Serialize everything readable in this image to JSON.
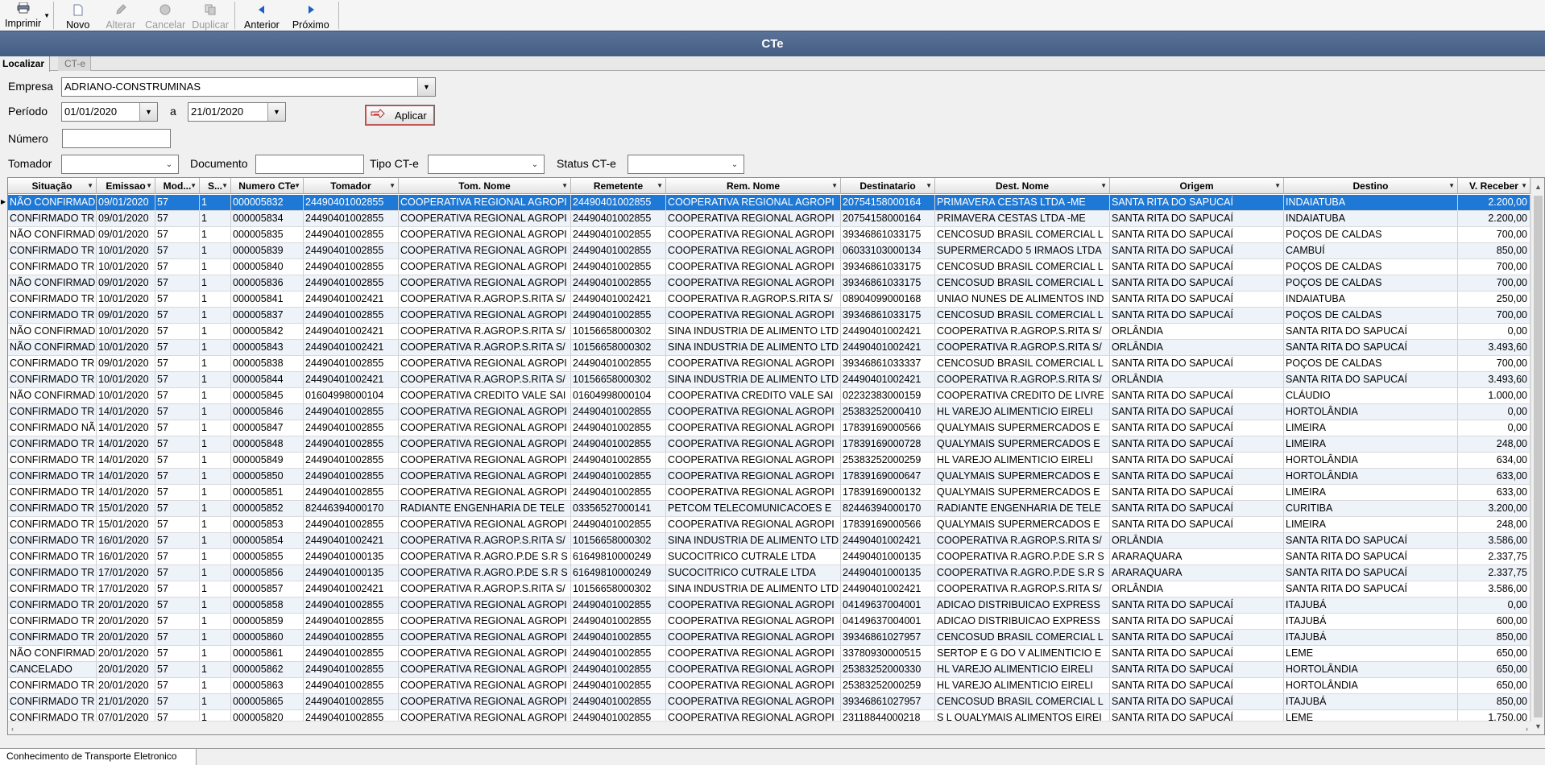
{
  "toolbar": {
    "items": [
      {
        "label": "Imprimir",
        "icon": "printer-icon",
        "enabled": true
      },
      {
        "label": "Novo",
        "icon": "new-document-icon",
        "enabled": true
      },
      {
        "label": "Alterar",
        "icon": "pencil-icon",
        "enabled": false
      },
      {
        "label": "Cancelar",
        "icon": "cancel-icon",
        "enabled": false
      },
      {
        "label": "Duplicar",
        "icon": "duplicate-icon",
        "enabled": false
      },
      {
        "label": "Anterior",
        "icon": "arrow-left-icon",
        "enabled": true
      },
      {
        "label": "Próximo",
        "icon": "arrow-right-icon",
        "enabled": true
      }
    ]
  },
  "window": {
    "title": "CTe"
  },
  "tabs": {
    "active": "Localizar",
    "inactive": "CT-e"
  },
  "filters": {
    "empresa_label": "Empresa",
    "empresa_value": "ADRIANO-CONSTRUMINAS",
    "periodo_label": "Período",
    "periodo_from": "01/01/2020",
    "periodo_sep": "a",
    "periodo_to": "21/01/2020",
    "numero_label": "Número",
    "numero_value": "",
    "tomador_label": "Tomador",
    "tomador_value": "",
    "documento_label": "Documento",
    "documento_value": "",
    "tipo_label": "Tipo CT-e",
    "tipo_value": "",
    "status_label": "Status CT-e",
    "status_value": "",
    "apply_label": "Aplicar"
  },
  "grid": {
    "columns": [
      "Situação",
      "Emissao",
      "Mod...",
      "S...",
      "Numero CTe",
      "Tomador",
      "Tom. Nome",
      "Remetente",
      "Rem. Nome",
      "Destinatario",
      "Dest. Nome",
      "Origem",
      "Destino",
      "V. Receber"
    ],
    "rows": [
      [
        "NÃO CONFIRMAD",
        "09/01/2020",
        "57",
        "1",
        "000005832",
        "24490401002855",
        "COOPERATIVA REGIONAL AGROPI",
        "24490401002855",
        "COOPERATIVA REGIONAL AGROPI",
        "20754158000164",
        "PRIMAVERA CESTAS LTDA -ME",
        "SANTA RITA DO SAPUCAÍ",
        "INDAIATUBA",
        "2.200,00"
      ],
      [
        "CONFIRMADO TR",
        "09/01/2020",
        "57",
        "1",
        "000005834",
        "24490401002855",
        "COOPERATIVA REGIONAL AGROPI",
        "24490401002855",
        "COOPERATIVA REGIONAL AGROPI",
        "20754158000164",
        "PRIMAVERA CESTAS LTDA -ME",
        "SANTA RITA DO SAPUCAÍ",
        "INDAIATUBA",
        "2.200,00"
      ],
      [
        "NÃO CONFIRMAD",
        "09/01/2020",
        "57",
        "1",
        "000005835",
        "24490401002855",
        "COOPERATIVA REGIONAL AGROPI",
        "24490401002855",
        "COOPERATIVA REGIONAL AGROPI",
        "39346861033175",
        "CENCOSUD BRASIL COMERCIAL L",
        "SANTA RITA DO SAPUCAÍ",
        "POÇOS DE CALDAS",
        "700,00"
      ],
      [
        "CONFIRMADO TR",
        "10/01/2020",
        "57",
        "1",
        "000005839",
        "24490401002855",
        "COOPERATIVA REGIONAL AGROPI",
        "24490401002855",
        "COOPERATIVA REGIONAL AGROPI",
        "06033103000134",
        "SUPERMERCADO 5 IRMAOS LTDA",
        "SANTA RITA DO SAPUCAÍ",
        "CAMBUÍ",
        "850,00"
      ],
      [
        "CONFIRMADO TR",
        "10/01/2020",
        "57",
        "1",
        "000005840",
        "24490401002855",
        "COOPERATIVA REGIONAL AGROPI",
        "24490401002855",
        "COOPERATIVA REGIONAL AGROPI",
        "39346861033175",
        "CENCOSUD BRASIL COMERCIAL L",
        "SANTA RITA DO SAPUCAÍ",
        "POÇOS DE CALDAS",
        "700,00"
      ],
      [
        "NÃO CONFIRMAD",
        "09/01/2020",
        "57",
        "1",
        "000005836",
        "24490401002855",
        "COOPERATIVA REGIONAL AGROPI",
        "24490401002855",
        "COOPERATIVA REGIONAL AGROPI",
        "39346861033175",
        "CENCOSUD BRASIL COMERCIAL L",
        "SANTA RITA DO SAPUCAÍ",
        "POÇOS DE CALDAS",
        "700,00"
      ],
      [
        "CONFIRMADO TR",
        "10/01/2020",
        "57",
        "1",
        "000005841",
        "24490401002421",
        "COOPERATIVA R.AGROP.S.RITA S/",
        "24490401002421",
        "COOPERATIVA R.AGROP.S.RITA S/",
        "08904099000168",
        "UNIAO NUNES DE ALIMENTOS IND",
        "SANTA RITA DO SAPUCAÍ",
        "INDAIATUBA",
        "250,00"
      ],
      [
        "CONFIRMADO TR",
        "09/01/2020",
        "57",
        "1",
        "000005837",
        "24490401002855",
        "COOPERATIVA REGIONAL AGROPI",
        "24490401002855",
        "COOPERATIVA REGIONAL AGROPI",
        "39346861033175",
        "CENCOSUD BRASIL COMERCIAL L",
        "SANTA RITA DO SAPUCAÍ",
        "POÇOS DE CALDAS",
        "700,00"
      ],
      [
        "NÃO CONFIRMAD",
        "10/01/2020",
        "57",
        "1",
        "000005842",
        "24490401002421",
        "COOPERATIVA R.AGROP.S.RITA S/",
        "10156658000302",
        "SINA INDUSTRIA DE ALIMENTO LTD",
        "24490401002421",
        "COOPERATIVA R.AGROP.S.RITA S/",
        "ORLÂNDIA",
        "SANTA RITA DO SAPUCAÍ",
        "0,00"
      ],
      [
        "NÃO CONFIRMAD",
        "10/01/2020",
        "57",
        "1",
        "000005843",
        "24490401002421",
        "COOPERATIVA R.AGROP.S.RITA S/",
        "10156658000302",
        "SINA INDUSTRIA DE ALIMENTO LTD",
        "24490401002421",
        "COOPERATIVA R.AGROP.S.RITA S/",
        "ORLÂNDIA",
        "SANTA RITA DO SAPUCAÍ",
        "3.493,60"
      ],
      [
        "CONFIRMADO TR",
        "09/01/2020",
        "57",
        "1",
        "000005838",
        "24490401002855",
        "COOPERATIVA REGIONAL AGROPI",
        "24490401002855",
        "COOPERATIVA REGIONAL AGROPI",
        "39346861033337",
        "CENCOSUD BRASIL COMERCIAL L",
        "SANTA RITA DO SAPUCAÍ",
        "POÇOS DE CALDAS",
        "700,00"
      ],
      [
        "CONFIRMADO TR",
        "10/01/2020",
        "57",
        "1",
        "000005844",
        "24490401002421",
        "COOPERATIVA R.AGROP.S.RITA S/",
        "10156658000302",
        "SINA INDUSTRIA DE ALIMENTO LTD",
        "24490401002421",
        "COOPERATIVA R.AGROP.S.RITA S/",
        "ORLÂNDIA",
        "SANTA RITA DO SAPUCAÍ",
        "3.493,60"
      ],
      [
        "NÃO CONFIRMAD",
        "10/01/2020",
        "57",
        "1",
        "000005845",
        "01604998000104",
        "COOPERATIVA CREDITO VALE SAI",
        "01604998000104",
        "COOPERATIVA CREDITO VALE SAI",
        "02232383000159",
        "COOPERATIVA CREDITO DE LIVRE",
        "SANTA RITA DO SAPUCAÍ",
        "CLÁUDIO",
        "1.000,00"
      ],
      [
        "CONFIRMADO TR",
        "14/01/2020",
        "57",
        "1",
        "000005846",
        "24490401002855",
        "COOPERATIVA REGIONAL AGROPI",
        "24490401002855",
        "COOPERATIVA REGIONAL AGROPI",
        "25383252000410",
        "HL VAREJO ALIMENTICIO EIRELI",
        "SANTA RITA DO SAPUCAÍ",
        "HORTOLÂNDIA",
        "0,00"
      ],
      [
        "CONFIRMADO NÃ",
        "14/01/2020",
        "57",
        "1",
        "000005847",
        "24490401002855",
        "COOPERATIVA REGIONAL AGROPI",
        "24490401002855",
        "COOPERATIVA REGIONAL AGROPI",
        "17839169000566",
        "QUALYMAIS SUPERMERCADOS E",
        "SANTA RITA DO SAPUCAÍ",
        "LIMEIRA",
        "0,00"
      ],
      [
        "CONFIRMADO TR",
        "14/01/2020",
        "57",
        "1",
        "000005848",
        "24490401002855",
        "COOPERATIVA REGIONAL AGROPI",
        "24490401002855",
        "COOPERATIVA REGIONAL AGROPI",
        "17839169000728",
        "QUALYMAIS SUPERMERCADOS E",
        "SANTA RITA DO SAPUCAÍ",
        "LIMEIRA",
        "248,00"
      ],
      [
        "CONFIRMADO TR",
        "14/01/2020",
        "57",
        "1",
        "000005849",
        "24490401002855",
        "COOPERATIVA REGIONAL AGROPI",
        "24490401002855",
        "COOPERATIVA REGIONAL AGROPI",
        "25383252000259",
        "HL VAREJO ALIMENTICIO EIRELI",
        "SANTA RITA DO SAPUCAÍ",
        "HORTOLÂNDIA",
        "634,00"
      ],
      [
        "CONFIRMADO TR",
        "14/01/2020",
        "57",
        "1",
        "000005850",
        "24490401002855",
        "COOPERATIVA REGIONAL AGROPI",
        "24490401002855",
        "COOPERATIVA REGIONAL AGROPI",
        "17839169000647",
        "QUALYMAIS SUPERMERCADOS E",
        "SANTA RITA DO SAPUCAÍ",
        "HORTOLÂNDIA",
        "633,00"
      ],
      [
        "CONFIRMADO TR",
        "14/01/2020",
        "57",
        "1",
        "000005851",
        "24490401002855",
        "COOPERATIVA REGIONAL AGROPI",
        "24490401002855",
        "COOPERATIVA REGIONAL AGROPI",
        "17839169000132",
        "QUALYMAIS SUPERMERCADOS E",
        "SANTA RITA DO SAPUCAÍ",
        "LIMEIRA",
        "633,00"
      ],
      [
        "CONFIRMADO TR",
        "15/01/2020",
        "57",
        "1",
        "000005852",
        "82446394000170",
        "RADIANTE ENGENHARIA DE TELE",
        "03356527000141",
        "PETCOM TELECOMUNICACOES E",
        "82446394000170",
        "RADIANTE ENGENHARIA DE TELE",
        "SANTA RITA DO SAPUCAÍ",
        "CURITIBA",
        "3.200,00"
      ],
      [
        "CONFIRMADO TR",
        "15/01/2020",
        "57",
        "1",
        "000005853",
        "24490401002855",
        "COOPERATIVA REGIONAL AGROPI",
        "24490401002855",
        "COOPERATIVA REGIONAL AGROPI",
        "17839169000566",
        "QUALYMAIS SUPERMERCADOS E",
        "SANTA RITA DO SAPUCAÍ",
        "LIMEIRA",
        "248,00"
      ],
      [
        "CONFIRMADO TR",
        "16/01/2020",
        "57",
        "1",
        "000005854",
        "24490401002421",
        "COOPERATIVA R.AGROP.S.RITA S/",
        "10156658000302",
        "SINA INDUSTRIA DE ALIMENTO LTD",
        "24490401002421",
        "COOPERATIVA R.AGROP.S.RITA S/",
        "ORLÂNDIA",
        "SANTA RITA DO SAPUCAÍ",
        "3.586,00"
      ],
      [
        "CONFIRMADO TR",
        "16/01/2020",
        "57",
        "1",
        "000005855",
        "24490401000135",
        "COOPERATIVA R.AGRO.P.DE S.R S",
        "61649810000249",
        "SUCOCITRICO CUTRALE LTDA",
        "24490401000135",
        "COOPERATIVA R.AGRO.P.DE S.R S",
        "ARARAQUARA",
        "SANTA RITA DO SAPUCAÍ",
        "2.337,75"
      ],
      [
        "CONFIRMADO TR",
        "17/01/2020",
        "57",
        "1",
        "000005856",
        "24490401000135",
        "COOPERATIVA R.AGRO.P.DE S.R S",
        "61649810000249",
        "SUCOCITRICO CUTRALE LTDA",
        "24490401000135",
        "COOPERATIVA R.AGRO.P.DE S.R S",
        "ARARAQUARA",
        "SANTA RITA DO SAPUCAÍ",
        "2.337,75"
      ],
      [
        "CONFIRMADO TR",
        "17/01/2020",
        "57",
        "1",
        "000005857",
        "24490401002421",
        "COOPERATIVA R.AGROP.S.RITA S/",
        "10156658000302",
        "SINA INDUSTRIA DE ALIMENTO LTD",
        "24490401002421",
        "COOPERATIVA R.AGROP.S.RITA S/",
        "ORLÂNDIA",
        "SANTA RITA DO SAPUCAÍ",
        "3.586,00"
      ],
      [
        "CONFIRMADO TR",
        "20/01/2020",
        "57",
        "1",
        "000005858",
        "24490401002855",
        "COOPERATIVA REGIONAL AGROPI",
        "24490401002855",
        "COOPERATIVA REGIONAL AGROPI",
        "04149637004001",
        "ADICAO DISTRIBUICAO EXPRESS",
        "SANTA RITA DO SAPUCAÍ",
        "ITAJUBÁ",
        "0,00"
      ],
      [
        "CONFIRMADO TR",
        "20/01/2020",
        "57",
        "1",
        "000005859",
        "24490401002855",
        "COOPERATIVA REGIONAL AGROPI",
        "24490401002855",
        "COOPERATIVA REGIONAL AGROPI",
        "04149637004001",
        "ADICAO DISTRIBUICAO EXPRESS",
        "SANTA RITA DO SAPUCAÍ",
        "ITAJUBÁ",
        "600,00"
      ],
      [
        "CONFIRMADO TR",
        "20/01/2020",
        "57",
        "1",
        "000005860",
        "24490401002855",
        "COOPERATIVA REGIONAL AGROPI",
        "24490401002855",
        "COOPERATIVA REGIONAL AGROPI",
        "39346861027957",
        "CENCOSUD BRASIL COMERCIAL L",
        "SANTA RITA DO SAPUCAÍ",
        "ITAJUBÁ",
        "850,00"
      ],
      [
        "NÃO CONFIRMAD",
        "20/01/2020",
        "57",
        "1",
        "000005861",
        "24490401002855",
        "COOPERATIVA REGIONAL AGROPI",
        "24490401002855",
        "COOPERATIVA REGIONAL AGROPI",
        "33780930000515",
        "SERTOP E G DO V ALIMENTICIO E",
        "SANTA RITA DO SAPUCAÍ",
        "LEME",
        "650,00"
      ],
      [
        "CANCELADO",
        "20/01/2020",
        "57",
        "1",
        "000005862",
        "24490401002855",
        "COOPERATIVA REGIONAL AGROPI",
        "24490401002855",
        "COOPERATIVA REGIONAL AGROPI",
        "25383252000330",
        "HL VAREJO ALIMENTICIO EIRELI",
        "SANTA RITA DO SAPUCAÍ",
        "HORTOLÂNDIA",
        "650,00"
      ],
      [
        "CONFIRMADO TR",
        "20/01/2020",
        "57",
        "1",
        "000005863",
        "24490401002855",
        "COOPERATIVA REGIONAL AGROPI",
        "24490401002855",
        "COOPERATIVA REGIONAL AGROPI",
        "25383252000259",
        "HL VAREJO ALIMENTICIO EIRELI",
        "SANTA RITA DO SAPUCAÍ",
        "HORTOLÂNDIA",
        "650,00"
      ],
      [
        "CONFIRMADO TR",
        "21/01/2020",
        "57",
        "1",
        "000005865",
        "24490401002855",
        "COOPERATIVA REGIONAL AGROPI",
        "24490401002855",
        "COOPERATIVA REGIONAL AGROPI",
        "39346861027957",
        "CENCOSUD BRASIL COMERCIAL L",
        "SANTA RITA DO SAPUCAÍ",
        "ITAJUBÁ",
        "850,00"
      ],
      [
        "CONFIRMADO TR",
        "07/01/2020",
        "57",
        "1",
        "000005820",
        "24490401002855",
        "COOPERATIVA REGIONAL AGROPI",
        "24490401002855",
        "COOPERATIVA REGIONAL AGROPI",
        "23118844000218",
        "S L QUALYMAIS ALIMENTOS EIREI",
        "SANTA RITA DO SAPUCAÍ",
        "LEME",
        "1.750,00"
      ]
    ]
  },
  "status_tab": "Conhecimento de Transporte Eletronico"
}
